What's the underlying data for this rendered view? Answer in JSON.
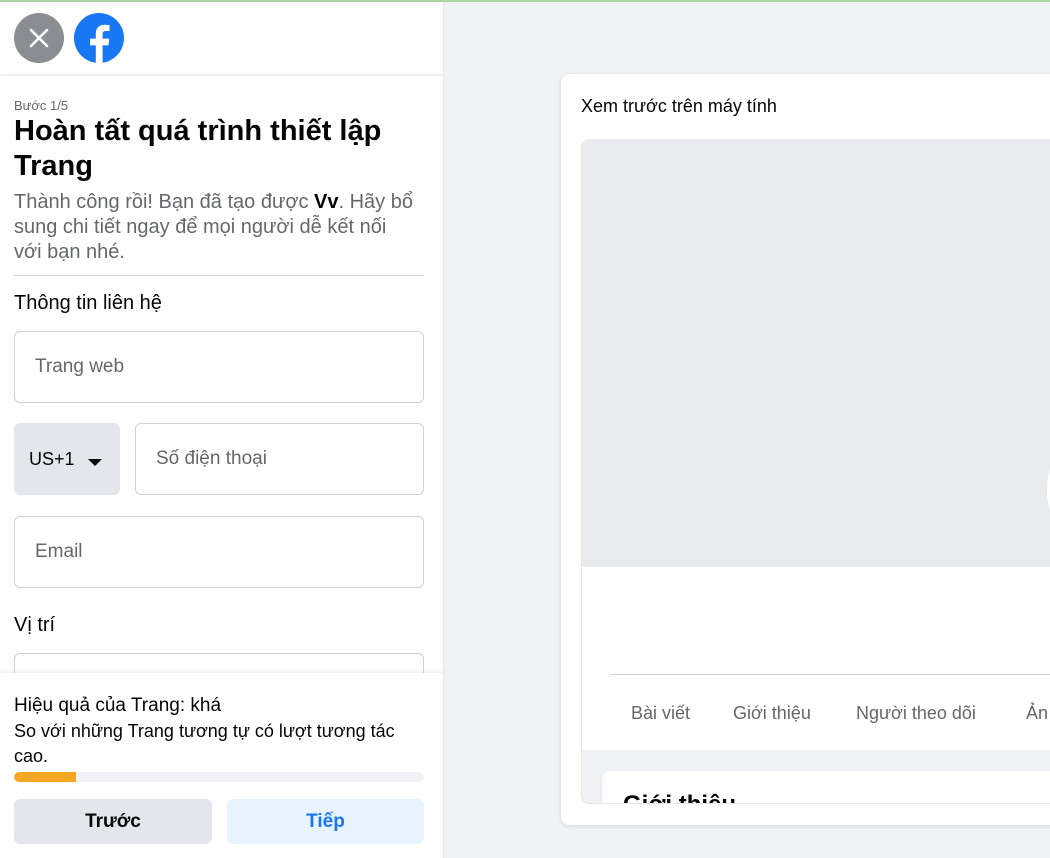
{
  "header": {
    "close_icon": "close-icon",
    "logo_icon": "facebook-logo-icon"
  },
  "setup": {
    "step": "Bước 1/5",
    "title": "Hoàn tất quá trình thiết lập Trang",
    "subtitle_before": "Thành công rồi! Bạn đã tạo được ",
    "page_name": "Vv",
    "subtitle_after": ". Hãy bổ sung chi tiết ngay để mọi người dễ kết nối với bạn nhé."
  },
  "contact": {
    "label": "Thông tin liên hệ",
    "website_placeholder": "Trang web",
    "country_code": "US+1",
    "phone_placeholder": "Số điện thoại",
    "email_placeholder": "Email"
  },
  "location": {
    "label": "Vị trí"
  },
  "performance": {
    "title": "Hiệu quả của Trang: khá",
    "description": "So với những Trang tương tự có lượt tương tác cao.",
    "progress_fraction": 0.15,
    "progress_color": "#f5a623"
  },
  "buttons": {
    "prev": "Trước",
    "next": "Tiếp"
  },
  "preview": {
    "title": "Xem trước trên máy tính",
    "tabs": [
      "Bài viết",
      "Giới thiệu",
      "Người theo dõi",
      "Ản"
    ],
    "intro_title": "Giới thiệu"
  },
  "colors": {
    "brand": "#1877f2",
    "background": "#f0f2f5"
  }
}
